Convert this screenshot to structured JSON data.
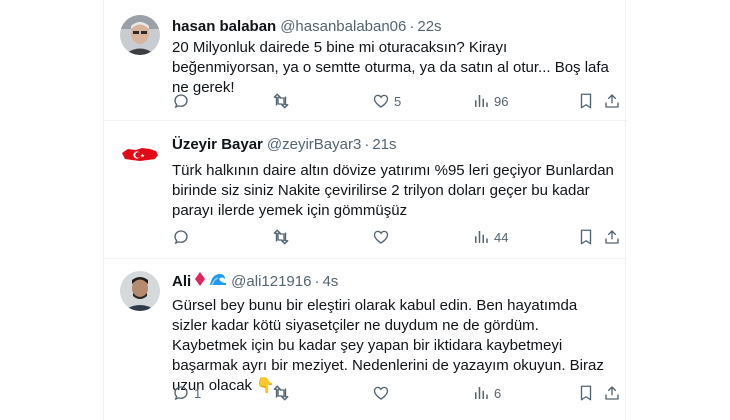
{
  "tweets": [
    {
      "name": "hasan balaban",
      "handle": "@hasanbalaban06",
      "time": "22s",
      "text": "20 Milyonluk dairede 5 bine mi oturacaksın? Kirayı beğenmiyorsan, ya o semtte oturma, ya da satın al otur... Boş lafa ne gerek!",
      "replies": "",
      "retweets": "",
      "likes": "5",
      "views": "96"
    },
    {
      "name": "Üzeyir Bayar",
      "handle": "@zeyirBayar3",
      "time": "21s",
      "text": "Türk halkının daire altın dövize yatırımı  %95 leri geçiyor Bunlardan birinde siz siniz  Nakite çevirilirse 2 trilyon doları geçer bu kadar parayı ilerde yemek için gömmüşüz",
      "replies": "",
      "retweets": "",
      "likes": "",
      "views": "44"
    },
    {
      "name": "Ali",
      "handle": "@ali121916",
      "time": "4s",
      "text": "Gürsel bey bunu bir eleştiri olarak kabul edin. Ben hayatımda sizler kadar kötü siyasetçiler ne duydum ne de gördüm. Kaybetmek için bu kadar şey yapan bir iktidara kaybetmeyi başarmak ayrı bir meziyet. Nedenlerini de yazayım okuyun. Biraz uzun olacak 👇",
      "replies": "1",
      "retweets": "",
      "likes": "",
      "views": "6"
    }
  ],
  "colors": {
    "text": "#0f1419",
    "secondary": "#536471",
    "border": "#eff3f4",
    "flag_red": "#e30a17"
  },
  "icons": [
    "reply-icon",
    "retweet-icon",
    "like-icon",
    "views-icon",
    "bookmark-icon",
    "share-icon",
    "diamond-badge-icon",
    "wave-badge-icon",
    "turkey-flag-avatar"
  ]
}
